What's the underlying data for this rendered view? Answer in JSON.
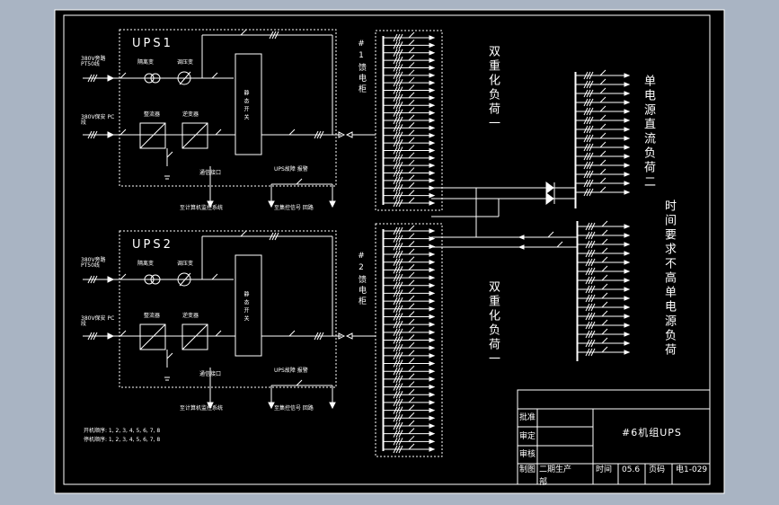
{
  "colors": {
    "background": "#a9b4c3",
    "sheet": "#000000",
    "line": "#ffffff"
  },
  "ups1": {
    "name": "UPS1",
    "input_bypass": "380V旁路 PT50线",
    "input_main": "380V保安 PC段",
    "isolation_tf": "隔离变",
    "regulator_tf": "调压变",
    "rectifier": "整流器",
    "inverter": "逆变器",
    "static_switch": "静态开关",
    "comm_port": "通信接口",
    "to_dcs": "至计算机监控系统",
    "alarm": "UPS故障 报警",
    "to_remote": "至集控信号 回路"
  },
  "ups2": {
    "name": "UPS2",
    "input_bypass": "380V旁路 PT50线",
    "input_main": "380V保安 PC段",
    "isolation_tf": "隔离变",
    "regulator_tf": "调压变",
    "rectifier": "整流器",
    "inverter": "逆变器",
    "static_switch": "静态开关",
    "comm_port": "通信接口",
    "to_dcs": "至计算机监控系统",
    "alarm": "UPS故障 报警",
    "to_remote": "至集控信号 回路"
  },
  "feeder1": "#1馈电柜",
  "feeder2": "#2馈电柜",
  "dual_load_1": "双重化负荷一",
  "dual_load_2": "双重化负荷一",
  "single_load_2": "单电源直流负荷二",
  "single_load_not_required": "时间要求不高单电源负荷",
  "sequence": {
    "start": "开机顺序: 1, 2, 3, 4, 5, 6, 7, 8",
    "stop": "停机顺序: 1, 2, 3, 4, 5, 6, 7, 8"
  },
  "title_block": {
    "approve": "批准",
    "review": "审定",
    "check": "审核",
    "draw": "制图",
    "stage": "二期生产",
    "sheet_label": "部",
    "title": "#6机组UPS",
    "time_label": "时间",
    "time_value": "05.6",
    "page_label": "页码",
    "page_value": "电1-029"
  }
}
